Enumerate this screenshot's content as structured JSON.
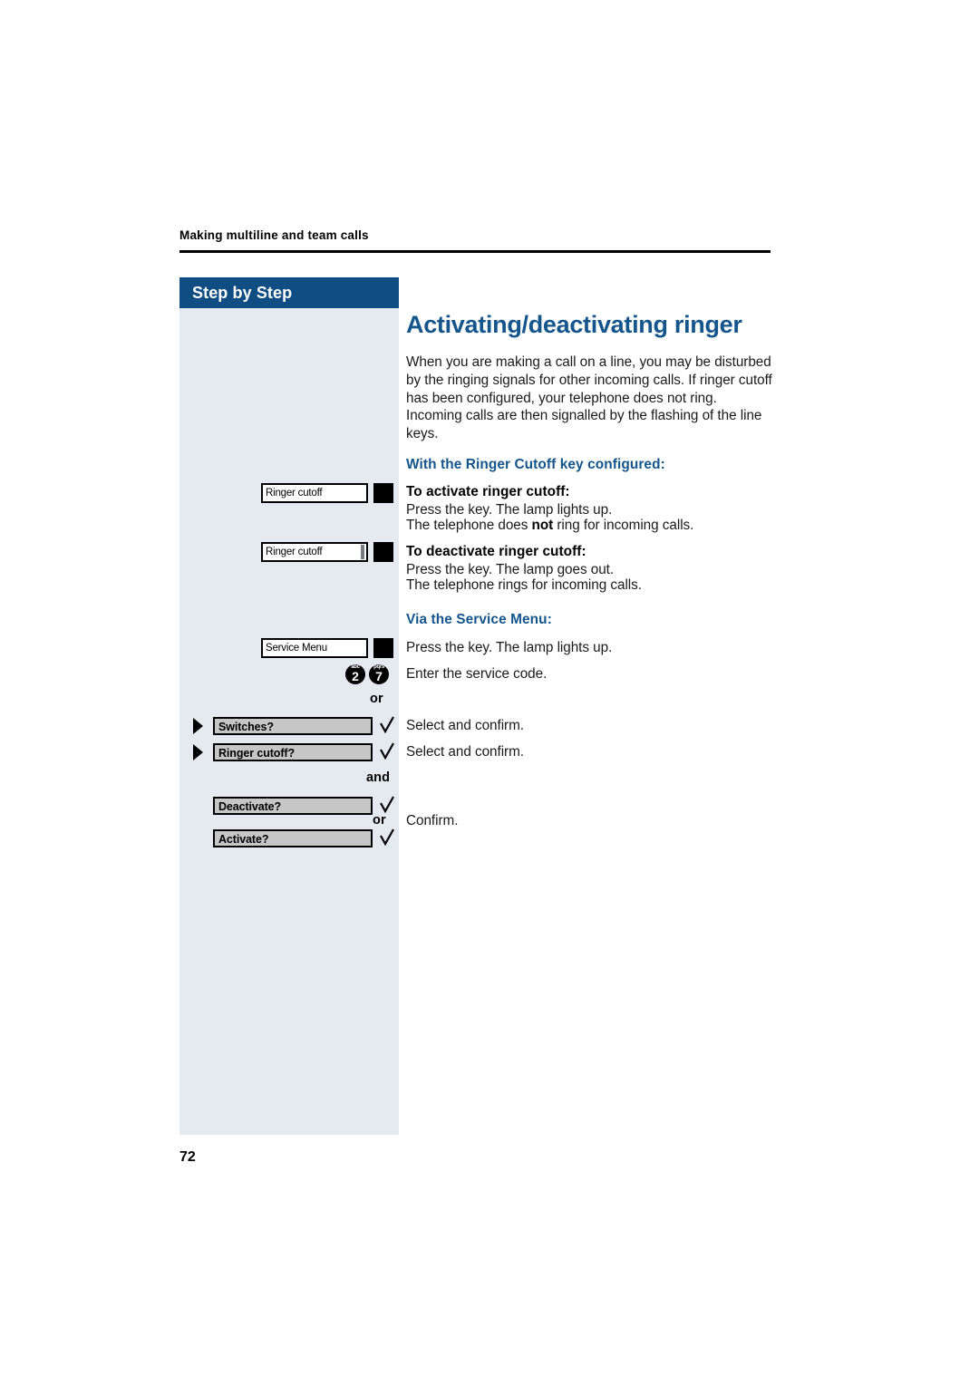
{
  "running_header": {
    "text": "Making multiline and team calls"
  },
  "sidebar": {
    "header_label": "Step by Step",
    "header_bg": "#0f4d82",
    "panel_bg": "#e4eaf0",
    "keys": [
      {
        "label": "Ringer cutoff",
        "lamp": "on",
        "has_bar": false
      },
      {
        "label": "Ringer cutoff",
        "lamp": "on",
        "has_bar": true
      },
      {
        "label": "Service Menu",
        "lamp": "on",
        "has_bar": false
      }
    ],
    "keypad": [
      {
        "digit": "2",
        "letters": "abc"
      },
      {
        "digit": "7",
        "letters": "pqrs"
      }
    ],
    "options": [
      {
        "label": "Switches?",
        "arrow": true,
        "check": true
      },
      {
        "label": "Ringer cutoff?",
        "arrow": true,
        "check": true
      },
      {
        "label": "Deactivate?",
        "arrow": false,
        "check": true
      },
      {
        "label": "Activate?",
        "arrow": false,
        "check": true
      }
    ],
    "connectors": {
      "or_keypad": "or",
      "and": "and",
      "or_options": "or"
    }
  },
  "main": {
    "title": "Activating/deactivating ringer",
    "title_color": "#14558c",
    "intro": "When you are making a call on a line, you may be disturbed by the ringing signals for other incoming calls. If ringer cutoff has been configured, your telephone does not ring. Incoming calls are then signalled by the flashing of the line keys.",
    "section_1": {
      "heading": "With the Ringer Cutoff key configured:",
      "sub_1": {
        "heading": "To activate ringer cutoff:",
        "line_1": "Press the key. The lamp lights up.",
        "line_2_before": "The telephone does ",
        "line_2_bold": "not",
        "line_2_after": " ring for incoming calls."
      },
      "sub_2": {
        "heading": "To deactivate ringer cutoff:",
        "line_1": "Press the key. The lamp goes out.",
        "line_2": "The telephone rings for incoming calls."
      }
    },
    "section_2": {
      "heading": "Via the Service Menu:",
      "line_1": "Press the key. The lamp lights up.",
      "line_2": "Enter the service code.",
      "line_3": "Select and confirm.",
      "line_4": "Select and confirm.",
      "line_5": "Confirm."
    }
  },
  "page_number": "72"
}
